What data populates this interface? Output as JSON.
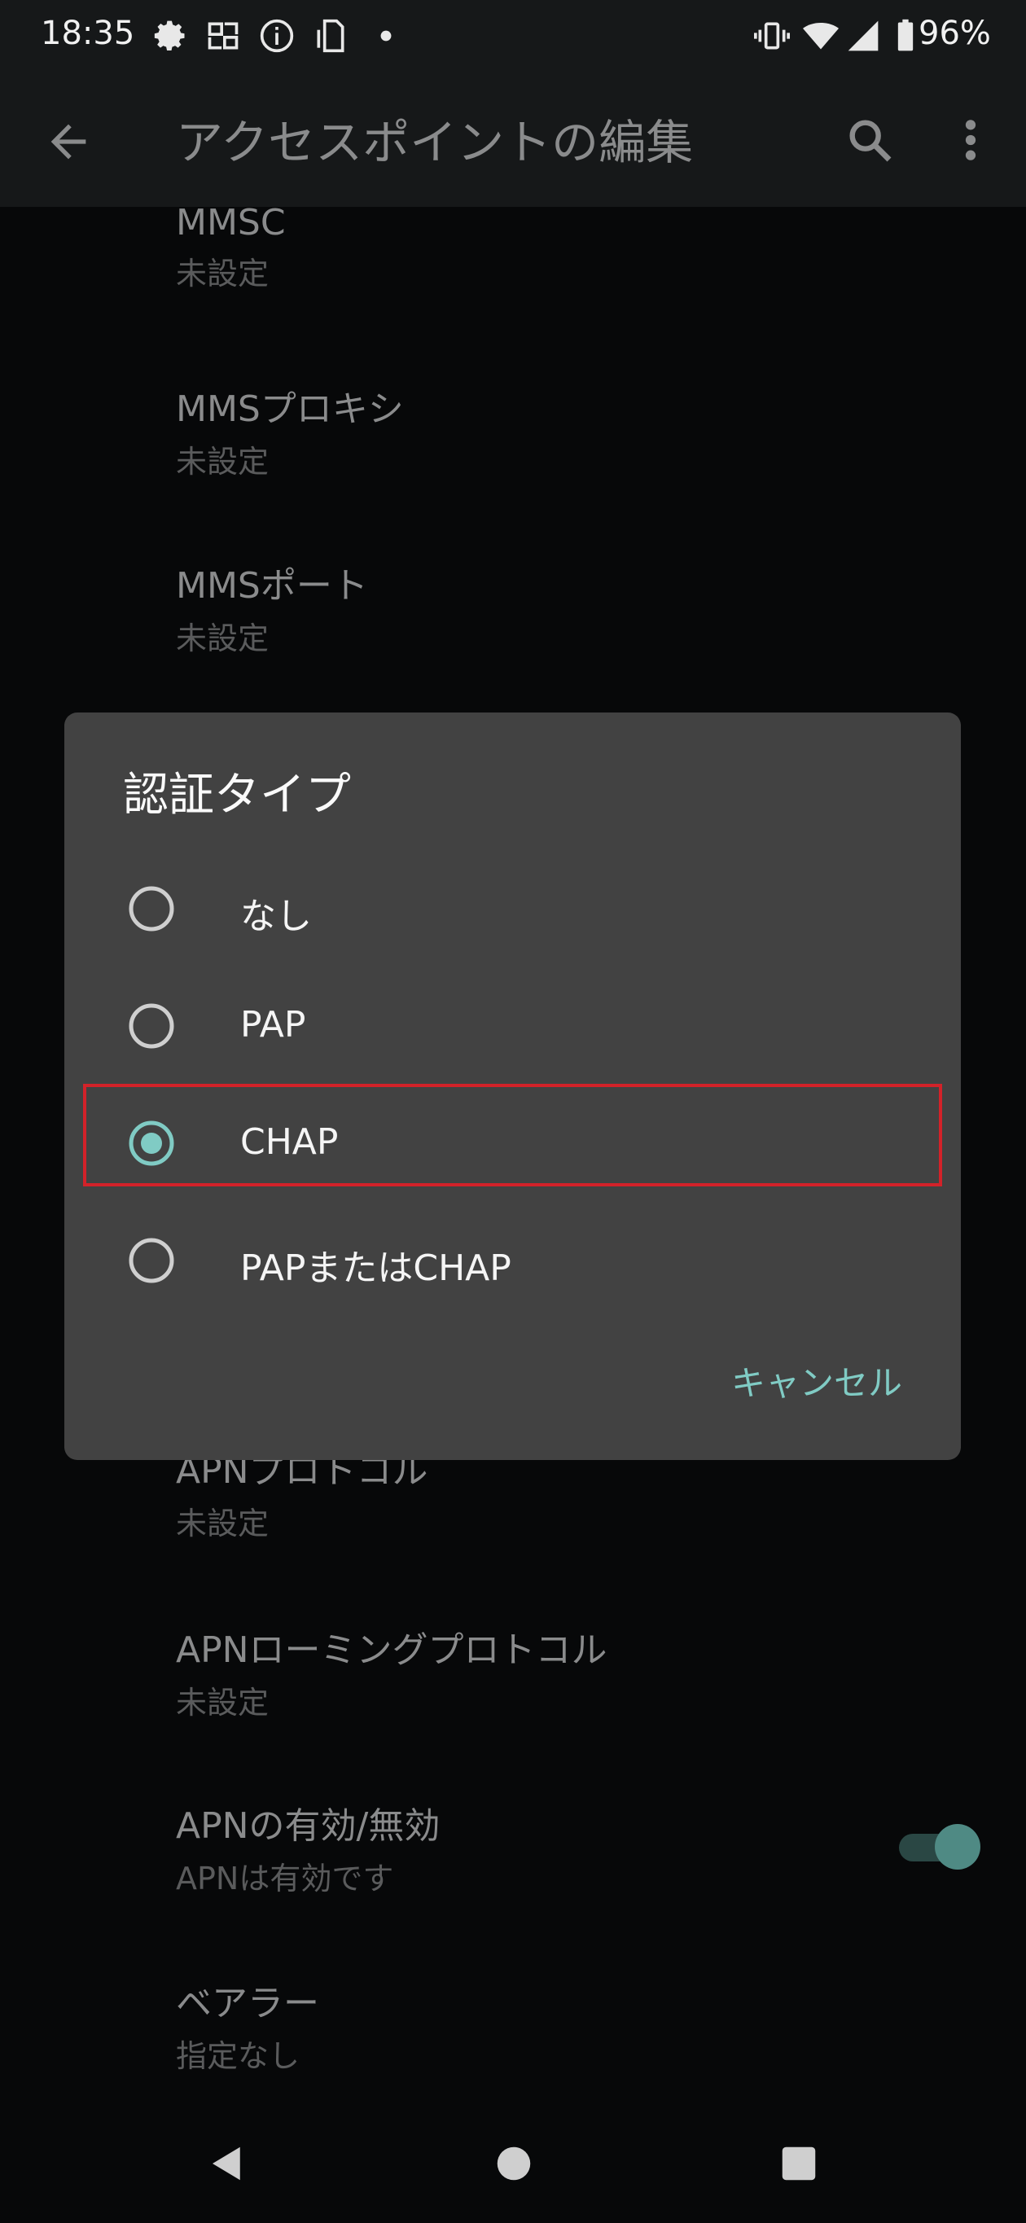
{
  "status_bar": {
    "time": "18:35",
    "left_icons": [
      "gear-icon",
      "screen-cast-icon",
      "info-icon",
      "sim-card-icon",
      "dot-icon"
    ],
    "right_icons": [
      "vibrate-icon",
      "wifi-icon",
      "signal-icon",
      "battery-icon"
    ],
    "battery_percent": "96%"
  },
  "app_bar": {
    "back_icon": "arrow-back-icon",
    "title": "アクセスポイントの編集",
    "search_icon": "search-icon",
    "more_icon": "more-vertical-icon"
  },
  "settings": [
    {
      "title": "MMSC",
      "summary": "未設定"
    },
    {
      "title": "MMSプロキシ",
      "summary": "未設定"
    },
    {
      "title": "MMSポート",
      "summary": "未設定"
    },
    {
      "title": "APNプロトコル",
      "summary": "未設定"
    },
    {
      "title": "APNローミングプロトコル",
      "summary": "未設定"
    },
    {
      "title": "APNの有効/無効",
      "summary": "APNは有効です",
      "toggle_on": true
    },
    {
      "title": "ベアラー",
      "summary": "指定なし"
    }
  ],
  "dialog": {
    "title": "認証タイプ",
    "options": [
      {
        "label": "なし",
        "selected": false
      },
      {
        "label": "PAP",
        "selected": false
      },
      {
        "label": "CHAP",
        "selected": true
      },
      {
        "label": "PAPまたはCHAP",
        "selected": false
      }
    ],
    "cancel_label": "キャンセル"
  },
  "colors": {
    "accent": "#80cbc4",
    "dialog_bg": "#424242",
    "highlight": "#d32229",
    "background": "#070809"
  },
  "nav_bar": {
    "icons": [
      "back-triangle-icon",
      "home-circle-icon",
      "recents-square-icon"
    ]
  }
}
